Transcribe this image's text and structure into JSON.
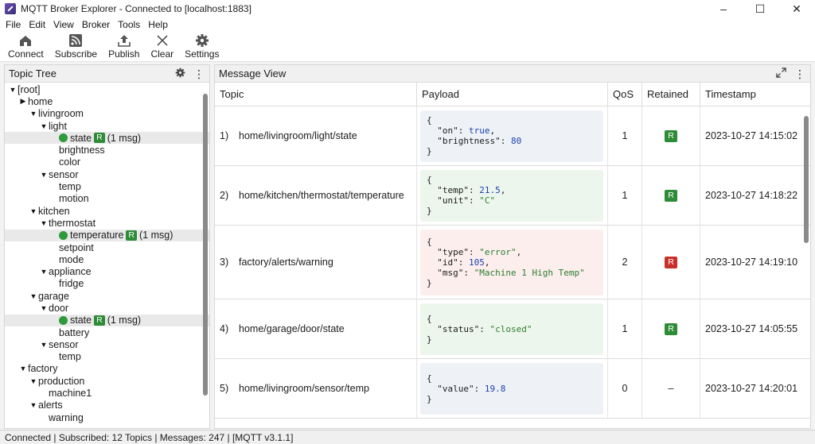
{
  "window": {
    "title": "MQTT Broker Explorer - Connected to [localhost:1883]",
    "controls": {
      "minimize": "–",
      "maximize": "☐",
      "close": "✕"
    }
  },
  "menu": [
    "File",
    "Edit",
    "View",
    "Broker",
    "Tools",
    "Help"
  ],
  "toolbar": [
    {
      "label": "Connect",
      "icon": "connect-icon"
    },
    {
      "label": "Subscribe",
      "icon": "rss-icon"
    },
    {
      "label": "Publish",
      "icon": "upload-icon"
    },
    {
      "label": "Clear",
      "icon": "close-icon"
    },
    {
      "label": "Settings",
      "icon": "gear-icon"
    }
  ],
  "topic_tree": {
    "title": "Topic Tree",
    "nodes": [
      {
        "label": "[root]",
        "depth": 0,
        "toggle": "▼"
      },
      {
        "label": "home",
        "depth": 1,
        "toggle": "▶"
      },
      {
        "label": "livingroom",
        "depth": 2,
        "toggle": "▼"
      },
      {
        "label": "light",
        "depth": 3,
        "toggle": "▼"
      },
      {
        "label": "state",
        "depth": 4,
        "toggle": "",
        "dot": true,
        "badge": "R",
        "count": "(1 msg)",
        "active": true
      },
      {
        "label": "brightness",
        "depth": 4,
        "toggle": ""
      },
      {
        "label": "color",
        "depth": 4,
        "toggle": ""
      },
      {
        "label": "sensor",
        "depth": 3,
        "toggle": "▼"
      },
      {
        "label": "temp",
        "depth": 4,
        "toggle": ""
      },
      {
        "label": "motion",
        "depth": 4,
        "toggle": ""
      },
      {
        "label": "kitchen",
        "depth": 2,
        "toggle": "▼"
      },
      {
        "label": "thermostat",
        "depth": 3,
        "toggle": "▼"
      },
      {
        "label": "temperature",
        "depth": 4,
        "toggle": "",
        "dot": true,
        "badge": "R",
        "count": "(1 msg)",
        "active": true
      },
      {
        "label": "setpoint",
        "depth": 4,
        "toggle": ""
      },
      {
        "label": "mode",
        "depth": 4,
        "toggle": ""
      },
      {
        "label": "appliance",
        "depth": 3,
        "toggle": "▼"
      },
      {
        "label": "fridge",
        "depth": 4,
        "toggle": ""
      },
      {
        "label": "garage",
        "depth": 2,
        "toggle": "▼"
      },
      {
        "label": "door",
        "depth": 3,
        "toggle": "▼"
      },
      {
        "label": "state",
        "depth": 4,
        "toggle": "",
        "dot": true,
        "badge": "R",
        "count": "(1 msg)",
        "active": true
      },
      {
        "label": "battery",
        "depth": 4,
        "toggle": ""
      },
      {
        "label": "sensor",
        "depth": 3,
        "toggle": "▼"
      },
      {
        "label": "temp",
        "depth": 4,
        "toggle": ""
      },
      {
        "label": "factory",
        "depth": 1,
        "toggle": "▼"
      },
      {
        "label": "production",
        "depth": 2,
        "toggle": "▼"
      },
      {
        "label": "machine1",
        "depth": 3,
        "toggle": ""
      },
      {
        "label": "alerts",
        "depth": 2,
        "toggle": "▼"
      },
      {
        "label": "warning",
        "depth": 3,
        "toggle": ""
      }
    ]
  },
  "message_view": {
    "title": "Message View",
    "columns": {
      "topic": "Topic",
      "payload": "Payload",
      "qos": "QoS",
      "retained": "Retained",
      "timestamp": "Timestamp"
    },
    "rows": [
      {
        "num": "1)",
        "topic": "home/livingroom/light/state",
        "qos": "1",
        "retained": "R",
        "retained_color": "#2e8b36",
        "timestamp": "2023-10-27 14:15:02",
        "payload_bg": "#eef2f6",
        "payload": [
          [
            [
              "p",
              "{"
            ]
          ],
          [
            [
              "p",
              "  "
            ],
            [
              "k",
              "\"on\""
            ],
            [
              "p",
              ": "
            ],
            [
              "b",
              "true"
            ],
            [
              "p",
              ","
            ]
          ],
          [
            [
              "p",
              "  "
            ],
            [
              "k",
              "\"brightness\""
            ],
            [
              "p",
              ": "
            ],
            [
              "n",
              "80"
            ]
          ],
          [
            [
              "p",
              "}"
            ]
          ]
        ]
      },
      {
        "num": "2)",
        "topic": "home/kitchen/thermostat/temperature",
        "qos": "1",
        "retained": "R",
        "retained_color": "#2e8b36",
        "timestamp": "2023-10-27 14:18:22",
        "payload_bg": "#edf6ec",
        "payload": [
          [
            [
              "p",
              "{"
            ]
          ],
          [
            [
              "p",
              "  "
            ],
            [
              "k",
              "\"temp\""
            ],
            [
              "p",
              ": "
            ],
            [
              "n",
              "21.5"
            ],
            [
              "p",
              ","
            ]
          ],
          [
            [
              "p",
              "  "
            ],
            [
              "k",
              "\"unit\""
            ],
            [
              "p",
              ": "
            ],
            [
              "s",
              "\"C\""
            ]
          ],
          [
            [
              "p",
              "}"
            ]
          ]
        ]
      },
      {
        "num": "3)",
        "topic": "factory/alerts/warning",
        "qos": "2",
        "retained": "R",
        "retained_color": "#c9302c",
        "timestamp": "2023-10-27 14:19:10",
        "payload_bg": "#fbeeed",
        "payload": [
          [
            [
              "p",
              "{"
            ]
          ],
          [
            [
              "p",
              "  "
            ],
            [
              "k",
              "\"type\""
            ],
            [
              "p",
              ": "
            ],
            [
              "s",
              "\"error\""
            ],
            [
              "p",
              ","
            ]
          ],
          [
            [
              "p",
              "  "
            ],
            [
              "k",
              "\"id\""
            ],
            [
              "p",
              ": "
            ],
            [
              "n",
              "105"
            ],
            [
              "p",
              ","
            ]
          ],
          [
            [
              "p",
              "  "
            ],
            [
              "k",
              "\"msg\""
            ],
            [
              "p",
              ": "
            ],
            [
              "s",
              "\"Machine 1 High Temp\""
            ]
          ],
          [
            [
              "p",
              "}"
            ]
          ]
        ]
      },
      {
        "num": "4)",
        "topic": "home/garage/door/state",
        "qos": "1",
        "retained": "R",
        "retained_color": "#2e8b36",
        "timestamp": "2023-10-27 14:05:55",
        "payload_bg": "#edf6ec",
        "payload": [
          [
            [
              "p",
              "{"
            ]
          ],
          [
            [
              "p",
              "  "
            ],
            [
              "k",
              "\"status\""
            ],
            [
              "p",
              ": "
            ],
            [
              "s",
              "\"closed\""
            ]
          ],
          [
            [
              "p",
              "}"
            ]
          ]
        ]
      },
      {
        "num": "5)",
        "topic": "home/livingroom/sensor/temp",
        "qos": "0",
        "retained": "–",
        "retained_color": "",
        "timestamp": "2023-10-27 14:20:01",
        "payload_bg": "#eef2f6",
        "payload": [
          [
            [
              "p",
              "{"
            ]
          ],
          [
            [
              "p",
              "  "
            ],
            [
              "k",
              "\"value\""
            ],
            [
              "p",
              ": "
            ],
            [
              "n",
              "19.8"
            ]
          ],
          [
            [
              "p",
              "}"
            ]
          ]
        ]
      }
    ]
  },
  "status": "Connected | Subscribed: 12 Topics | Messages: 247 | [MQTT v3.1.1]"
}
